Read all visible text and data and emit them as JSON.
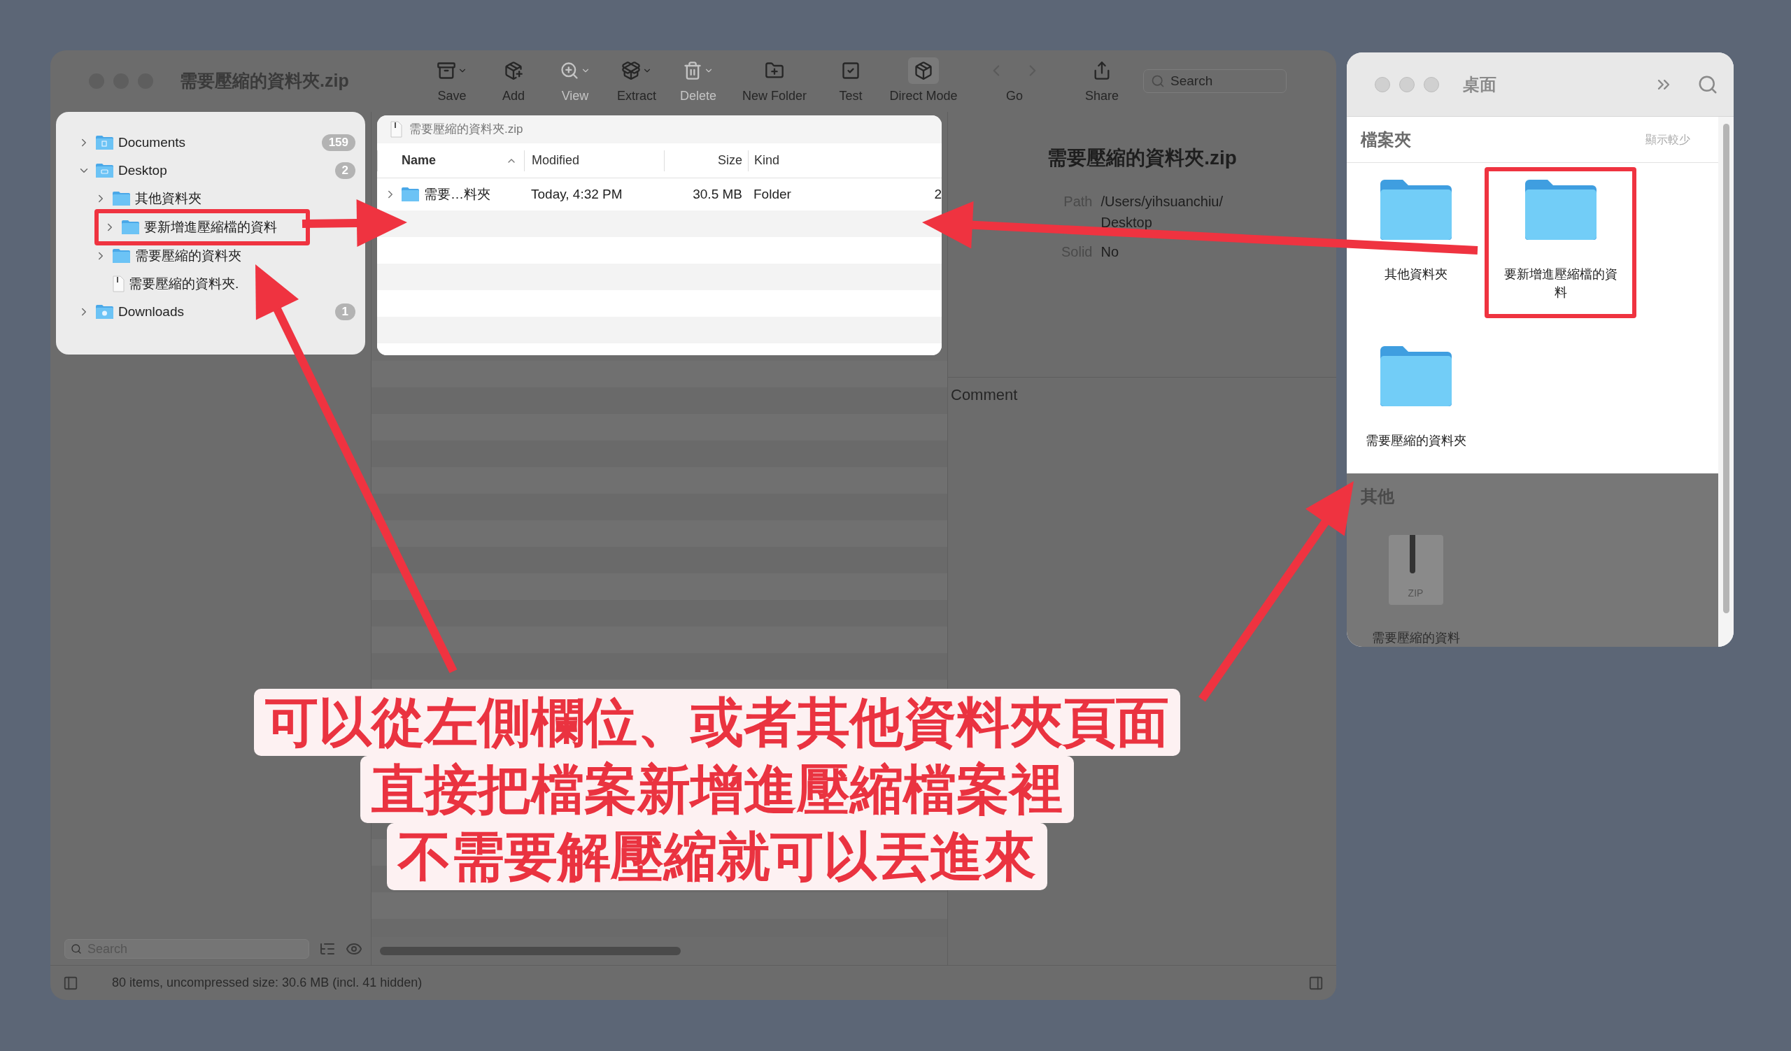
{
  "window": {
    "title": "需要壓縮的資料夾.zip"
  },
  "toolbar": [
    {
      "label": "Save",
      "kind": "menu",
      "disabled": false,
      "on": false
    },
    {
      "label": "Add",
      "kind": "button",
      "disabled": false,
      "on": false
    },
    {
      "label": "View",
      "kind": "menu",
      "disabled": true,
      "on": false
    },
    {
      "label": "Extract",
      "kind": "menu",
      "disabled": false,
      "on": false
    },
    {
      "label": "Delete",
      "kind": "menu",
      "disabled": true,
      "on": false
    },
    {
      "label": "New Folder",
      "kind": "button",
      "disabled": false,
      "on": false
    },
    {
      "label": "Test",
      "kind": "button",
      "disabled": false,
      "on": false
    },
    {
      "label": "Direct Mode",
      "kind": "button",
      "disabled": false,
      "on": true
    },
    {
      "label": "Go",
      "kind": "nav",
      "disabled": false,
      "on": false
    },
    {
      "label": "Share",
      "kind": "button",
      "disabled": false,
      "on": false
    }
  ],
  "search": {
    "placeholder": "Search"
  },
  "sidebar": {
    "items": [
      {
        "label": "Documents",
        "kind": "documents",
        "badge": "159",
        "expanded": false,
        "highlighted": false
      },
      {
        "label": "Desktop",
        "kind": "desktop",
        "badge": "2",
        "expanded": true,
        "highlighted": false,
        "children": [
          {
            "label": "其他資料夾",
            "kind": "folder",
            "expanded": false,
            "highlighted": false
          },
          {
            "label": "要新增進壓縮檔的資料",
            "kind": "folder",
            "expanded": false,
            "highlighted": true
          },
          {
            "label": "需要壓縮的資料夾",
            "kind": "folder",
            "expanded": false,
            "highlighted": false
          },
          {
            "label": "需要壓縮的資料夾.",
            "kind": "file",
            "highlighted": false
          }
        ]
      },
      {
        "label": "Downloads",
        "kind": "downloads",
        "badge": "1",
        "expanded": false,
        "highlighted": false
      }
    ]
  },
  "sidebar_search": {
    "placeholder": "Search"
  },
  "file_list": {
    "path": "需要壓縮的資料夾.zip",
    "columns": [
      {
        "label": "Name",
        "sorted": true
      },
      {
        "label": "Modified",
        "sorted": false
      },
      {
        "label": "Size",
        "sorted": false
      },
      {
        "label": "Kind",
        "sorted": false
      }
    ],
    "rows": [
      {
        "name": "需要…料夾",
        "modified": "Today, 4:32 PM",
        "size": "30.5 MB",
        "kind_text": "Folder",
        "column_5": "2",
        "expanded": false
      }
    ]
  },
  "info": {
    "title": "需要壓縮的資料夾.zip",
    "fields": [
      {
        "label": "Path",
        "value_lines": [
          "/Users/yihsuanchiu/",
          "Desktop"
        ]
      },
      {
        "label": "Solid",
        "value_lines": [
          "No"
        ]
      }
    ],
    "comment_placeholder": "Comment"
  },
  "status_bar": "80 items, uncompressed size: 30.6 MB (incl. 41 hidden)",
  "finder": {
    "title": "桌面",
    "sections": [
      {
        "title": "檔案夾",
        "action": "顯示較少",
        "dimmed": false,
        "items": [
          {
            "name": "其他資料夾",
            "kind": "folder",
            "highlighted": false
          },
          {
            "name": "要新增進壓縮檔的資料",
            "kind": "folder",
            "highlighted": true
          },
          {
            "name": "需要壓縮的資料夾",
            "kind": "folder",
            "highlighted": false
          }
        ]
      },
      {
        "title": "其他",
        "dimmed": true,
        "items": [
          {
            "name": "需要壓縮的資料",
            "kind": "zip",
            "icon_label": "ZIP",
            "highlighted": false
          }
        ]
      }
    ]
  },
  "annotation": {
    "lines": [
      "可以從左側欄位、或者其他資料夾頁面",
      "直接把檔案新增進壓縮檔案裡",
      "不需要解壓縮就可以丟進來"
    ]
  }
}
